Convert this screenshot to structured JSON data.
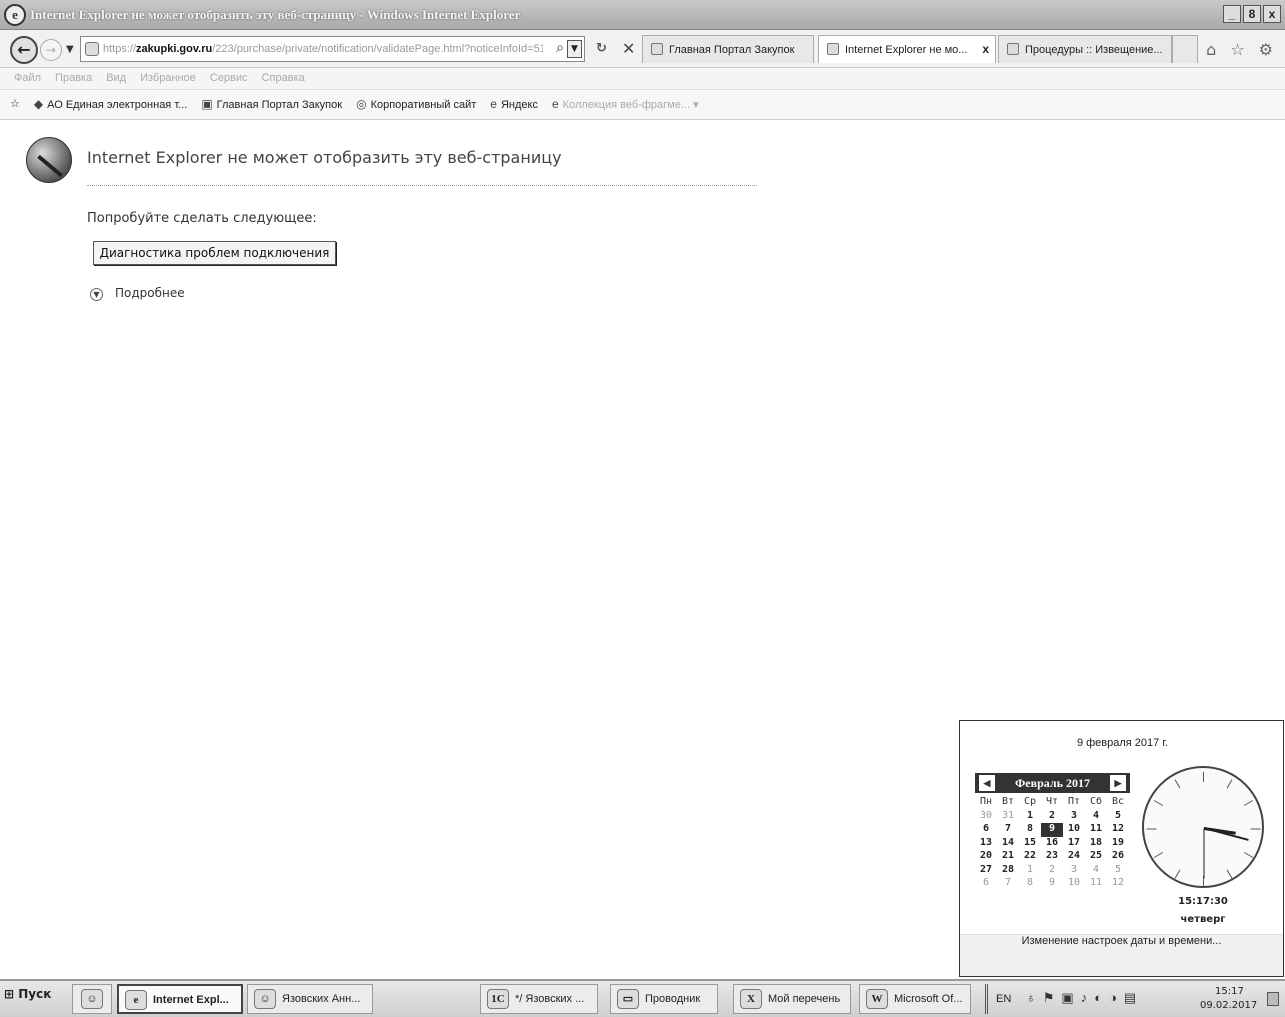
{
  "window": {
    "title": "Internet Explorer не может отобразить эту веб-страницу - Windows Internet Explorer",
    "controls": [
      "_",
      "8",
      "x"
    ]
  },
  "nav": {
    "url_prefix": "https://",
    "url_host": "zakupki.gov.ru",
    "url_path": "/223/purchase/private/notification/validatePage.html?noticeInfoId=51",
    "tabs": [
      {
        "label": "Главная Портал Закупок",
        "active": false
      },
      {
        "label": "Internet Explorer не мо...",
        "active": true,
        "close": "x"
      },
      {
        "label": "Процедуры :: Извещение...",
        "active": false
      }
    ]
  },
  "menu": [
    "Файл",
    "Правка",
    "Вид",
    "Избранное",
    "Сервис",
    "Справка"
  ],
  "favorites": [
    {
      "label": "АО Единая электронная т...",
      "icon": "diamond-icon"
    },
    {
      "label": "Главная Портал Закупок",
      "icon": "site-icon"
    },
    {
      "label": "Корпоративный сайт",
      "icon": "circle-icon"
    },
    {
      "label": "Яндекс",
      "icon": "ie-icon"
    },
    {
      "label": "Коллекция веб-фрагме...",
      "icon": "ie-icon"
    }
  ],
  "content": {
    "title": "Internet Explorer не может отобразить эту веб-страницу",
    "try_text": "Попробуйте сделать следующее:",
    "diag_button": "Диагностика проблем подключения",
    "more_text": "Подробнее"
  },
  "clock": {
    "date_long": "9 февраля 2017 г.",
    "month_label": "Февраль 2017",
    "weekdays": [
      "Пн",
      "Вт",
      "Ср",
      "Чт",
      "Пт",
      "Сб",
      "Вс"
    ],
    "weeks": [
      [
        {
          "d": "30",
          "m": true
        },
        {
          "d": "31",
          "m": true
        },
        {
          "d": "1"
        },
        {
          "d": "2"
        },
        {
          "d": "3"
        },
        {
          "d": "4"
        },
        {
          "d": "5"
        }
      ],
      [
        {
          "d": "6"
        },
        {
          "d": "7"
        },
        {
          "d": "8"
        },
        {
          "d": "9",
          "sel": true
        },
        {
          "d": "10"
        },
        {
          "d": "11"
        },
        {
          "d": "12"
        }
      ],
      [
        {
          "d": "13"
        },
        {
          "d": "14"
        },
        {
          "d": "15"
        },
        {
          "d": "16"
        },
        {
          "d": "17"
        },
        {
          "d": "18"
        },
        {
          "d": "19"
        }
      ],
      [
        {
          "d": "20"
        },
        {
          "d": "21"
        },
        {
          "d": "22"
        },
        {
          "d": "23"
        },
        {
          "d": "24"
        },
        {
          "d": "25"
        },
        {
          "d": "26"
        }
      ],
      [
        {
          "d": "27"
        },
        {
          "d": "28"
        },
        {
          "d": "1",
          "m": true
        },
        {
          "d": "2",
          "m": true
        },
        {
          "d": "3",
          "m": true
        },
        {
          "d": "4",
          "m": true
        },
        {
          "d": "5",
          "m": true
        }
      ],
      [
        {
          "d": "6",
          "m": true
        },
        {
          "d": "7",
          "m": true
        },
        {
          "d": "8",
          "m": true
        },
        {
          "d": "9",
          "m": true
        },
        {
          "d": "10",
          "m": true
        },
        {
          "d": "11",
          "m": true
        },
        {
          "d": "12",
          "m": true
        }
      ]
    ],
    "time": "15:17:30",
    "weekday_name": "четверг",
    "footer_link": "Изменение настроек даты и времени..."
  },
  "taskbar": {
    "start": "Пуск",
    "items": [
      {
        "label": "Internet Expl...",
        "active": true,
        "icon": "ie-icon",
        "glyph": "e"
      },
      {
        "label": "Язовских Анн...",
        "active": false,
        "icon": "user-icon",
        "glyph": "☺"
      },
      {
        "label": "*/ Язовских ...",
        "active": false,
        "icon": "1c-icon",
        "glyph": "1C"
      },
      {
        "label": "Проводник",
        "active": false,
        "icon": "folder-icon",
        "glyph": "▭"
      },
      {
        "label": "Мой перечень",
        "active": false,
        "icon": "excel-icon",
        "glyph": "X"
      },
      {
        "label": "Microsoft Of...",
        "active": false,
        "icon": "word-icon",
        "glyph": "W"
      }
    ],
    "tray_lang": "EN",
    "tray_time": "15:17",
    "tray_date": "09.02.2017"
  }
}
